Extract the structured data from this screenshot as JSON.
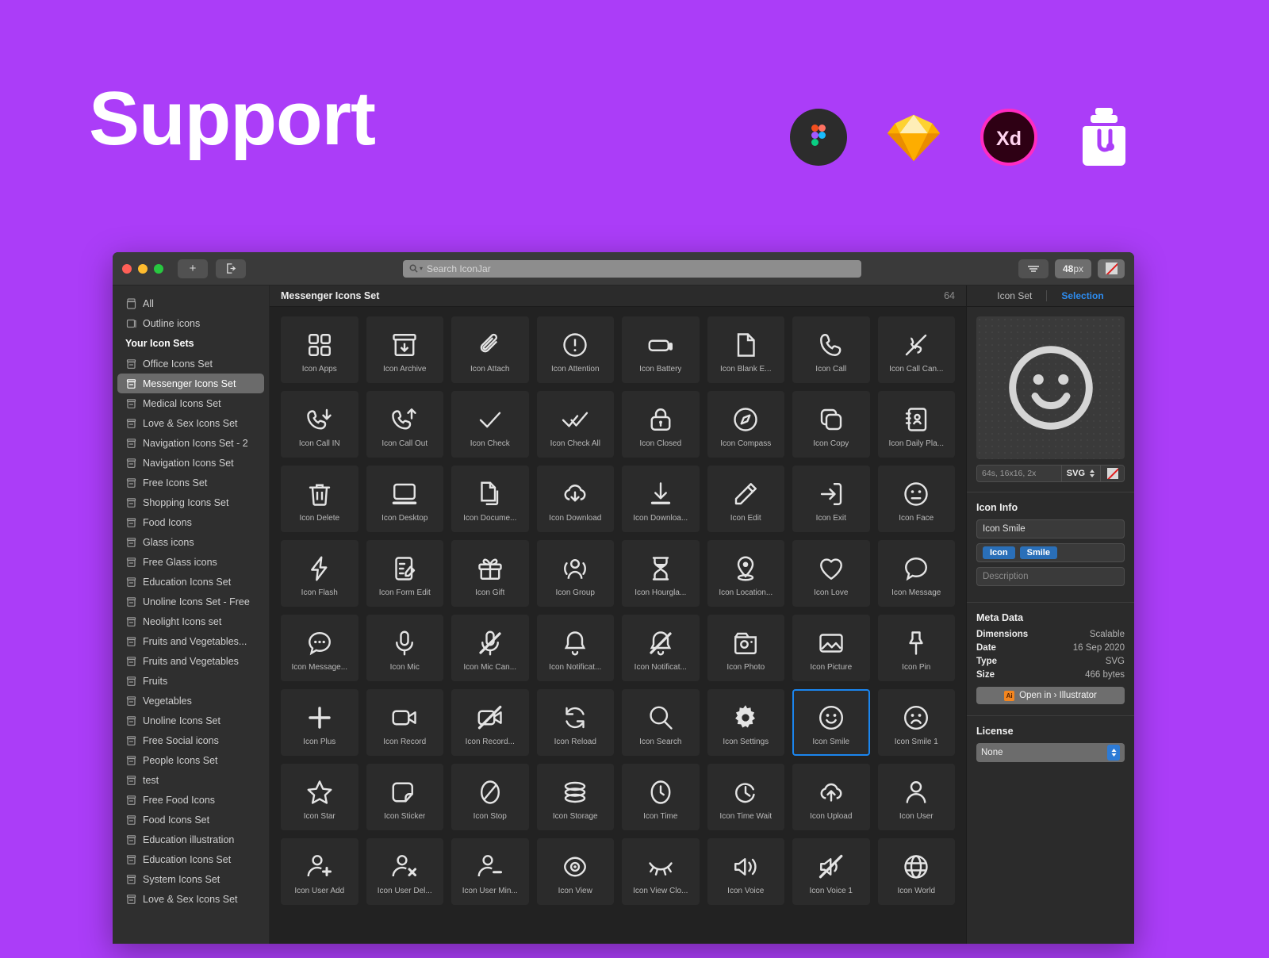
{
  "hero": {
    "title": "Support",
    "logos": [
      {
        "name": "figma-logo"
      },
      {
        "name": "sketch-logo"
      },
      {
        "name": "adobe-xd-logo",
        "label": "Xd"
      },
      {
        "name": "iconjar-logo"
      }
    ]
  },
  "titlebar": {
    "add_label": "+",
    "export_label": "export-icon",
    "search_placeholder": "Search IconJar",
    "search_value": "",
    "filter_label": "filter-icon",
    "size_value": "48",
    "size_unit": "px",
    "color_swatch": "#d8d8d8"
  },
  "sidebar": {
    "top_items": [
      {
        "label": "All",
        "icon": "jar-icon"
      },
      {
        "label": "Outline icons",
        "icon": "box-icon"
      }
    ],
    "group_header": "Your Icon Sets",
    "items": [
      {
        "label": "Office Icons Set"
      },
      {
        "label": "Messenger Icons Set",
        "selected": true
      },
      {
        "label": "Medical Icons Set"
      },
      {
        "label": "Love & Sex Icons Set"
      },
      {
        "label": "Navigation Icons Set - 2"
      },
      {
        "label": "Navigation Icons Set"
      },
      {
        "label": "Free Icons Set"
      },
      {
        "label": "Shopping Icons Set"
      },
      {
        "label": "Food Icons"
      },
      {
        "label": "Glass icons"
      },
      {
        "label": "Free Glass icons"
      },
      {
        "label": "Education Icons Set"
      },
      {
        "label": "Unoline Icons Set - Free"
      },
      {
        "label": "Neolight Icons set"
      },
      {
        "label": "Fruits and Vegetables..."
      },
      {
        "label": "Fruits and Vegetables"
      },
      {
        "label": "Fruits"
      },
      {
        "label": "Vegetables"
      },
      {
        "label": "Unoline Icons Set"
      },
      {
        "label": "Free Social icons"
      },
      {
        "label": "People Icons Set"
      },
      {
        "label": "test"
      },
      {
        "label": "Free Food Icons"
      },
      {
        "label": "Food Icons Set"
      },
      {
        "label": "Education illustration"
      },
      {
        "label": "Education Icons Set"
      },
      {
        "label": "System Icons Set"
      },
      {
        "label": "Love & Sex Icons Set"
      }
    ]
  },
  "center": {
    "title": "Messenger Icons Set",
    "count": "64",
    "icons": [
      {
        "label": "Icon Apps",
        "glyph": "apps"
      },
      {
        "label": "Icon Archive",
        "glyph": "archive"
      },
      {
        "label": "Icon Attach",
        "glyph": "attach"
      },
      {
        "label": "Icon Attention",
        "glyph": "attention"
      },
      {
        "label": "Icon Battery",
        "glyph": "battery"
      },
      {
        "label": "Icon Blank E...",
        "glyph": "blank"
      },
      {
        "label": "Icon Call",
        "glyph": "call"
      },
      {
        "label": "Icon Call Can...",
        "glyph": "call-cancel"
      },
      {
        "label": "Icon Call IN",
        "glyph": "call-in"
      },
      {
        "label": "Icon Call Out",
        "glyph": "call-out"
      },
      {
        "label": "Icon Check",
        "glyph": "check"
      },
      {
        "label": "Icon Check All",
        "glyph": "check-all"
      },
      {
        "label": "Icon Closed",
        "glyph": "lock"
      },
      {
        "label": "Icon Compass",
        "glyph": "compass"
      },
      {
        "label": "Icon Copy",
        "glyph": "copy"
      },
      {
        "label": "Icon Daily Pla...",
        "glyph": "daily-planner"
      },
      {
        "label": "Icon Delete",
        "glyph": "trash"
      },
      {
        "label": "Icon Desktop",
        "glyph": "desktop"
      },
      {
        "label": "Icon Docume...",
        "glyph": "documents"
      },
      {
        "label": "Icon Download",
        "glyph": "cloud-download"
      },
      {
        "label": "Icon Downloa...",
        "glyph": "download"
      },
      {
        "label": "Icon Edit",
        "glyph": "pencil"
      },
      {
        "label": "Icon Exit",
        "glyph": "exit"
      },
      {
        "label": "Icon Face",
        "glyph": "face"
      },
      {
        "label": "Icon Flash",
        "glyph": "flash"
      },
      {
        "label": "Icon Form Edit",
        "glyph": "form-edit"
      },
      {
        "label": "Icon Gift",
        "glyph": "gift"
      },
      {
        "label": "Icon Group",
        "glyph": "group"
      },
      {
        "label": "Icon Hourgla...",
        "glyph": "hourglass"
      },
      {
        "label": "Icon Location...",
        "glyph": "location"
      },
      {
        "label": "Icon Love",
        "glyph": "heart"
      },
      {
        "label": "Icon Message",
        "glyph": "message"
      },
      {
        "label": "Icon Message...",
        "glyph": "message-dots"
      },
      {
        "label": "Icon Mic",
        "glyph": "mic"
      },
      {
        "label": "Icon Mic Can...",
        "glyph": "mic-off"
      },
      {
        "label": "Icon Notificat...",
        "glyph": "bell"
      },
      {
        "label": "Icon Notificat...",
        "glyph": "bell-off"
      },
      {
        "label": "Icon Photo",
        "glyph": "photo"
      },
      {
        "label": "Icon Picture",
        "glyph": "picture"
      },
      {
        "label": "Icon Pin",
        "glyph": "pin"
      },
      {
        "label": "Icon Plus",
        "glyph": "plus"
      },
      {
        "label": "Icon Record",
        "glyph": "record"
      },
      {
        "label": "Icon Record...",
        "glyph": "record-off"
      },
      {
        "label": "Icon Reload",
        "glyph": "reload"
      },
      {
        "label": "Icon Search",
        "glyph": "search"
      },
      {
        "label": "Icon Settings",
        "glyph": "settings"
      },
      {
        "label": "Icon Smile",
        "glyph": "smile",
        "selected": true
      },
      {
        "label": "Icon Smile 1",
        "glyph": "sad"
      },
      {
        "label": "Icon Star",
        "glyph": "star"
      },
      {
        "label": "Icon Sticker",
        "glyph": "sticker"
      },
      {
        "label": "Icon Stop",
        "glyph": "stop"
      },
      {
        "label": "Icon Storage",
        "glyph": "storage"
      },
      {
        "label": "Icon Time",
        "glyph": "time"
      },
      {
        "label": "Icon Time Wait",
        "glyph": "time-wait"
      },
      {
        "label": "Icon Upload",
        "glyph": "cloud-upload"
      },
      {
        "label": "Icon User",
        "glyph": "user"
      },
      {
        "label": "Icon User Add",
        "glyph": "user-add"
      },
      {
        "label": "Icon User Del...",
        "glyph": "user-del"
      },
      {
        "label": "Icon User Min...",
        "glyph": "user-min"
      },
      {
        "label": "Icon View",
        "glyph": "view"
      },
      {
        "label": "Icon View Clo...",
        "glyph": "view-closed"
      },
      {
        "label": "Icon Voice",
        "glyph": "voice"
      },
      {
        "label": "Icon Voice 1",
        "glyph": "voice-off"
      },
      {
        "label": "Icon World",
        "glyph": "world"
      }
    ]
  },
  "inspector": {
    "tab_icon_set": "Icon Set",
    "tab_selection": "Selection",
    "preview_glyph": "smile",
    "preview_size": "64s, 16x16, 2x",
    "preview_format": "SVG",
    "info_header": "Icon Info",
    "name_value": "Icon Smile",
    "tags": [
      "Icon",
      "Smile"
    ],
    "description_placeholder": "Description",
    "meta_header": "Meta Data",
    "meta": [
      {
        "key": "Dimensions",
        "value": "Scalable"
      },
      {
        "key": "Date",
        "value": "16 Sep 2020"
      },
      {
        "key": "Type",
        "value": "SVG"
      },
      {
        "key": "Size",
        "value": "466 bytes"
      }
    ],
    "open_in_label": "Open in › Illustrator",
    "license_header": "License",
    "license_value": "None"
  },
  "colors": {
    "background": "#ab3df8",
    "accent_blue": "#2d8cf0",
    "selection_border": "#1b86ef",
    "tag_blue": "#2a6fb8"
  }
}
